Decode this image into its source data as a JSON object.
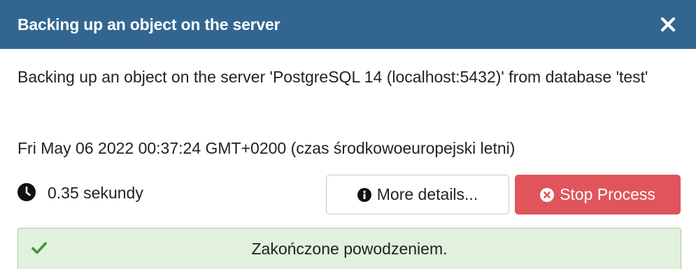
{
  "dialog": {
    "title": "Backing up an object on the server",
    "close_icon": "close-icon",
    "header_color": "#326690"
  },
  "process": {
    "description": "Backing up an object on the server 'PostgreSQL 14 (localhost:5432)' from database 'test'",
    "timestamp": "Fri May 06 2022 00:37:24 GMT+0200 (czas środkowoeuropejski letni)",
    "duration_icon": "clock-icon",
    "duration": "0.35 sekundy"
  },
  "actions": {
    "more_details_icon": "info-circle-icon",
    "more_details_label": "More details...",
    "stop_icon": "times-circle-icon",
    "stop_label": "Stop Process",
    "stop_color": "#e0555c"
  },
  "status": {
    "icon": "checkmark-icon",
    "message": "Zakończone powodzeniem.",
    "background": "#e1f1dd",
    "icon_color": "#3c9a2e"
  }
}
